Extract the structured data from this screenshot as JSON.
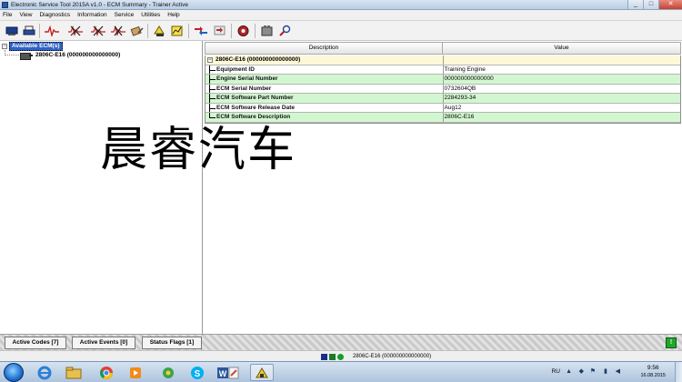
{
  "window": {
    "title": "Electronic Service Tool 2015A v1.0 - ECM Summary - Trainer Active",
    "controls": {
      "minimize": "_",
      "maximize": "□",
      "close": "✕"
    }
  },
  "menu": [
    "File",
    "View",
    "Diagnostics",
    "Information",
    "Service",
    "Utilities",
    "Help"
  ],
  "toolbar": {
    "icons": [
      "connect-icon",
      "print-icon",
      "heartbeat-icon",
      "active-codes-icon",
      "logged-codes-icon",
      "events-icon",
      "logged-events-icon",
      "status-icon",
      "graph-icon",
      "configuration-icon",
      "flash-icon",
      "service-icon",
      "favorites-icon",
      "ecm-icon",
      "search-icon"
    ]
  },
  "tree": {
    "root_label": "Available ECM(s)",
    "children": [
      {
        "label": "2806C-E16 (000000000000000)"
      }
    ]
  },
  "grid": {
    "columns": {
      "description": "Description",
      "value": "Value"
    },
    "group_label": "2806C-E16 (000000000000000)",
    "rows": [
      {
        "label": "Equipment ID",
        "value": "Training Engine"
      },
      {
        "label": "Engine Serial Number",
        "value": "000000000000000"
      },
      {
        "label": "ECM Serial Number",
        "value": "0732604QB"
      },
      {
        "label": "ECM Software Part Number",
        "value": "2284293-34"
      },
      {
        "label": "ECM Software Release Date",
        "value": "Aug12"
      },
      {
        "label": "ECM Software Description",
        "value": "2806C-E16"
      }
    ]
  },
  "watermark": "晨睿汽车",
  "tabs": [
    "Active Codes [7]",
    "Active Events [0]",
    "Status Flags [1]"
  ],
  "indicator": "!",
  "status": {
    "text": "2806C-E16 (000000000000000)"
  },
  "taskbar": {
    "apps": [
      "internet-explorer-icon",
      "file-explorer-icon",
      "chrome-icon",
      "media-player-icon",
      "puzzle-app-icon",
      "skype-icon",
      "word-icon",
      "paint-icon",
      "service-tool-icon"
    ],
    "language": "RU",
    "time": "9:56",
    "date": "16.08.2015"
  },
  "colors": {
    "selection": "#3163c5",
    "group_row": "#fff8d8",
    "alt_row": "#d2f7d0",
    "indicator": "#1fa62c"
  }
}
